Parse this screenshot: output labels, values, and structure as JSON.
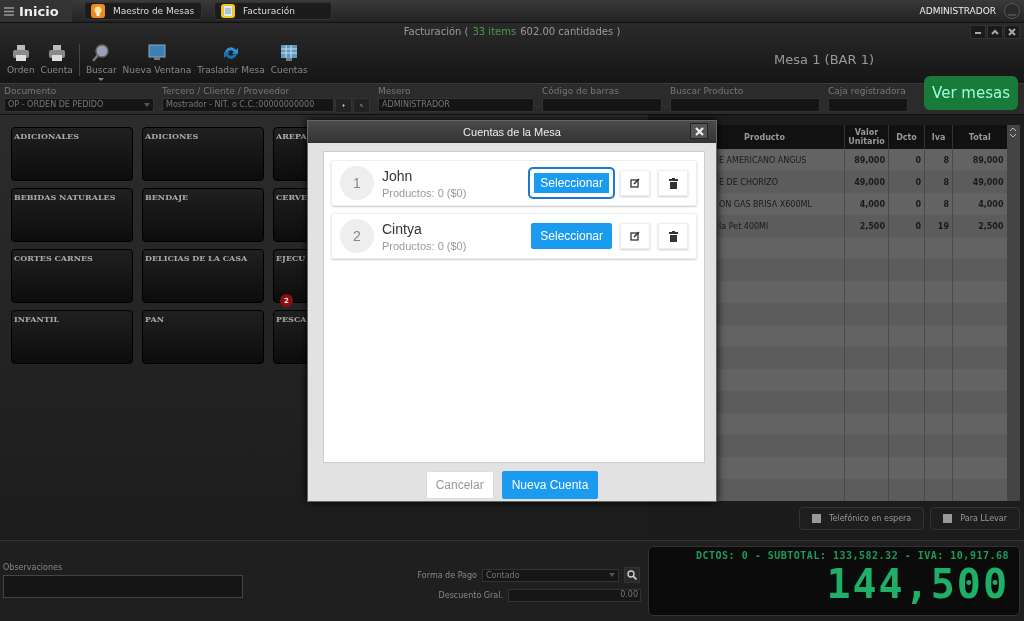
{
  "topbar": {
    "home": "Inicio",
    "tabs": [
      {
        "label": "Maestro de Mesas"
      },
      {
        "label": "Facturación"
      }
    ],
    "user": "ADMINISTRADOR"
  },
  "window": {
    "title": "Facturación (",
    "items": "33 items",
    "quantities": "602.00 cantidades )",
    "mesa": "Mesa 1 (BAR 1)"
  },
  "toolbar": [
    {
      "label": "Orden"
    },
    {
      "label": "Cuenta"
    },
    {
      "label": "Buscar"
    },
    {
      "label": "Nueva Ventana"
    },
    {
      "label": "Trasladar Mesa"
    },
    {
      "label": "Cuentas"
    }
  ],
  "fields": [
    {
      "label": "Documento",
      "kind": "select",
      "value": "OP - ORDEN DE PEDIDO"
    },
    {
      "label": "Tercero / Cliente / Proveedor",
      "kind": "lookup",
      "value": "Mostrador - NIT. o C.C.:00000000000"
    },
    {
      "label": "Mesero",
      "kind": "text",
      "value": "ADMINISTRADOR"
    },
    {
      "label": "Código de barras",
      "kind": "text"
    },
    {
      "label": "Buscar Producto",
      "kind": "text"
    },
    {
      "label": "Caja registradora",
      "kind": "text"
    }
  ],
  "ver_mesas": "Ver mesas",
  "categories": [
    {
      "label": "ADICIONALES"
    },
    {
      "label": "ADICIONES"
    },
    {
      "label": "AREPA"
    },
    {
      "label": "BEBIDAS NATURALES"
    },
    {
      "label": "BENDAJE"
    },
    {
      "label": "CERVE"
    },
    {
      "label": "CORTES CARNES"
    },
    {
      "label": "DELICIAS DE LA CASA"
    },
    {
      "label": "EJECU",
      "badge": "2"
    },
    {
      "label": "INFANTIL"
    },
    {
      "label": "PAN"
    },
    {
      "label": "PESCA"
    }
  ],
  "table": {
    "columns": [
      "Producto",
      "Valor Unitario",
      "Dcto",
      "Iva",
      "Total"
    ],
    "rows": [
      {
        "product": "E AMERICANO ANGUS",
        "price": "89,000",
        "discount": "0",
        "tax": "8",
        "total": "89,000"
      },
      {
        "product": "E DE CHORIZO",
        "price": "49,000",
        "discount": "0",
        "tax": "8",
        "total": "49,000"
      },
      {
        "product": "ON GAS BRISA X600ML",
        "price": "4,000",
        "discount": "0",
        "tax": "8",
        "total": "4,000"
      },
      {
        "product": "la Pet 400Ml",
        "price": "2,500",
        "discount": "0",
        "tax": "19",
        "total": "2,500"
      }
    ]
  },
  "options": [
    {
      "label": "Telefónico en espera",
      "checked": false
    },
    {
      "label": "Para LLevar",
      "checked": false
    }
  ],
  "observaciones": {
    "label": "Observaciones"
  },
  "payment": {
    "label": "Forma de Pago",
    "value": "Contado"
  },
  "discount": {
    "label": "Descuento Gral.",
    "value": "0.00"
  },
  "display": {
    "summary": "DCTOS: 0 - SUBTOTAL: 133,582.32 - IVA: 10,917.68",
    "total": "144,500"
  },
  "modal": {
    "title": "Cuentas de la Mesa",
    "accounts": [
      {
        "number": "1",
        "name": "John",
        "products": "Productos: 0 ($0)",
        "action": "Seleccionar",
        "selected": true
      },
      {
        "number": "2",
        "name": "Cintya",
        "products": "Productos: 0 ($0)",
        "action": "Seleccionar",
        "selected": false
      }
    ],
    "buttons": [
      {
        "label": "Cancelar",
        "kind": "secondary"
      },
      {
        "label": "Nueva Cuenta",
        "kind": "primary"
      }
    ]
  }
}
